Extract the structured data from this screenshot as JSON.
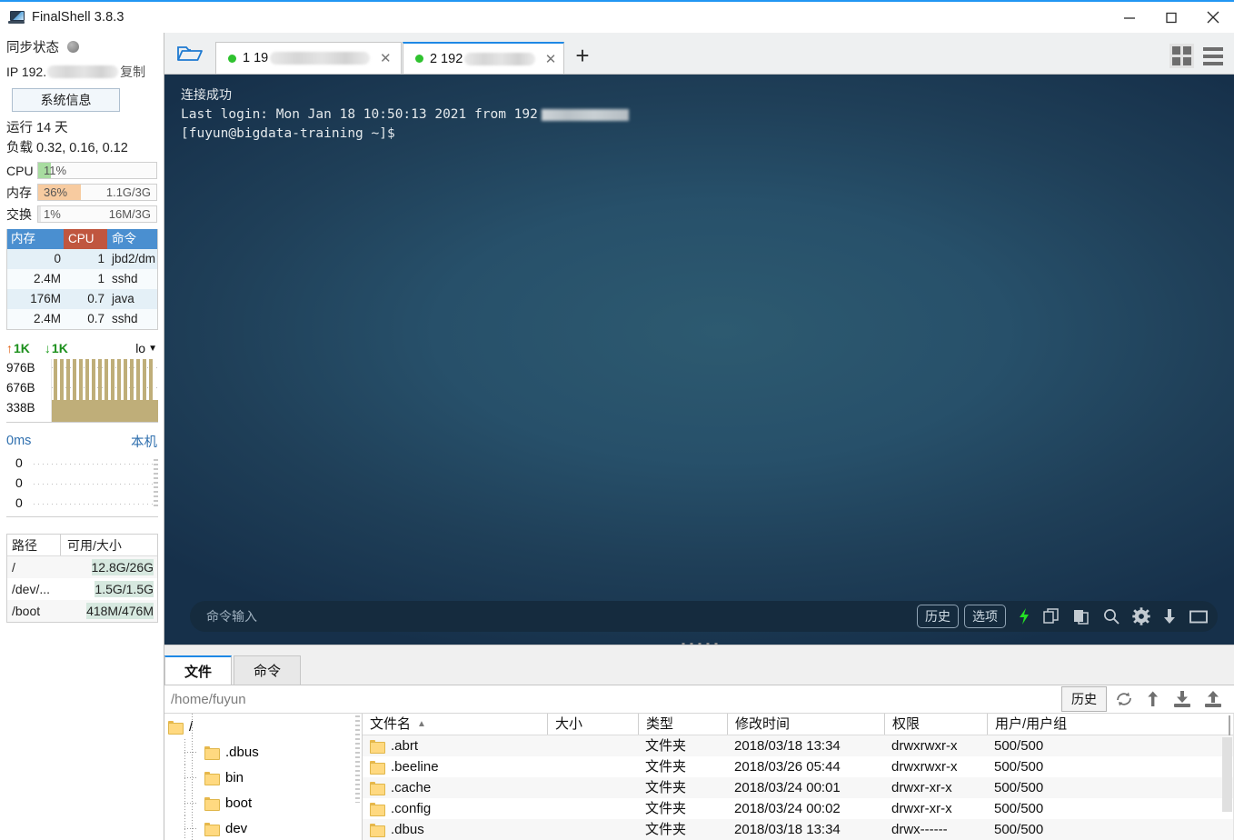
{
  "window": {
    "title": "FinalShell 3.8.3",
    "app_icon": "monitor-icon",
    "minimize": "minimize-icon",
    "maximize": "maximize-icon",
    "close": "close-icon"
  },
  "sidebar": {
    "sync_label": "同步状态",
    "ip_prefix": "IP 192.",
    "copy_label": "复制",
    "sysinfo_button": "系统信息",
    "uptime": "运行 14 天",
    "load": "负载 0.32, 0.16, 0.12",
    "meters": [
      {
        "label": "CPU",
        "percent": "11%",
        "fill": 11,
        "abs": "",
        "color": "#a8dca0"
      },
      {
        "label": "内存",
        "percent": "36%",
        "fill": 36,
        "abs": "1.1G/3G",
        "color": "#f7cba0"
      },
      {
        "label": "交换",
        "percent": "1%",
        "fill": 1,
        "abs": "16M/3G",
        "color": "#dddddd"
      }
    ],
    "process_table": {
      "headers": [
        "内存",
        "CPU",
        "命令"
      ],
      "rows": [
        {
          "mem": "0",
          "cpu": "1",
          "cmd": "jbd2/dm"
        },
        {
          "mem": "2.4M",
          "cpu": "1",
          "cmd": "sshd"
        },
        {
          "mem": "176M",
          "cpu": "0.7",
          "cmd": "java"
        },
        {
          "mem": "2.4M",
          "cpu": "0.7",
          "cmd": "sshd"
        }
      ]
    },
    "network": {
      "up_value": "1K",
      "down_value": "1K",
      "interface": "lo",
      "y_labels": [
        "976B",
        "676B",
        "338B"
      ]
    },
    "ping": {
      "latency": "0ms",
      "host": "本机",
      "y_labels": [
        "0",
        "0",
        "0"
      ]
    },
    "disks": {
      "headers": [
        "路径",
        "可用/大小"
      ],
      "rows": [
        {
          "path": "/",
          "usage": "12.8G/26G"
        },
        {
          "path": "/dev/...",
          "usage": "1.5G/1.5G"
        },
        {
          "path": "/boot",
          "usage": "418M/476M"
        }
      ]
    }
  },
  "tabbar": {
    "open_folder_icon": "open-folder-icon",
    "tabs": [
      {
        "label": "1 19",
        "active": false,
        "status": "connected"
      },
      {
        "label": "2 192",
        "active": true,
        "status": "connected"
      }
    ],
    "new_tab": "+",
    "grid_view_icon": "grid-view-icon",
    "menu_icon": "hamburger-menu-icon"
  },
  "terminal": {
    "line1": "连接成功",
    "line2": "Last login: Mon Jan 18 10:50:13 2021 from 192",
    "line3": "[fuyun@bigdata-training ~]$",
    "command_placeholder": "命令输入",
    "command_value": "",
    "history_button": "历史",
    "options_button": "选项",
    "icons": [
      "lightning-icon",
      "copy-icon",
      "paste-icon",
      "search-icon",
      "gear-icon",
      "download-icon",
      "window-icon"
    ]
  },
  "filepanel": {
    "tabs": [
      {
        "label": "文件",
        "active": true
      },
      {
        "label": "命令",
        "active": false
      }
    ],
    "path": "/home/fuyun",
    "history_button": "历史",
    "toolbar_icons": [
      "refresh-icon",
      "parent-dir-icon",
      "download-icon",
      "upload-icon"
    ],
    "tree": [
      {
        "label": "/",
        "depth": 0
      },
      {
        "label": ".dbus",
        "depth": 1
      },
      {
        "label": "bin",
        "depth": 1
      },
      {
        "label": "boot",
        "depth": 1
      },
      {
        "label": "dev",
        "depth": 1
      }
    ],
    "columns": [
      "文件名",
      "大小",
      "类型",
      "修改时间",
      "权限",
      "用户/用户组"
    ],
    "sort_indicator": "▲",
    "rows": [
      {
        "name": ".abrt",
        "size": "",
        "type": "文件夹",
        "mtime": "2018/03/18 13:34",
        "perm": "drwxrwxr-x",
        "owner": "500/500"
      },
      {
        "name": ".beeline",
        "size": "",
        "type": "文件夹",
        "mtime": "2018/03/26 05:44",
        "perm": "drwxrwxr-x",
        "owner": "500/500"
      },
      {
        "name": ".cache",
        "size": "",
        "type": "文件夹",
        "mtime": "2018/03/24 00:01",
        "perm": "drwxr-xr-x",
        "owner": "500/500"
      },
      {
        "name": ".config",
        "size": "",
        "type": "文件夹",
        "mtime": "2018/03/24 00:02",
        "perm": "drwxr-xr-x",
        "owner": "500/500"
      },
      {
        "name": ".dbus",
        "size": "",
        "type": "文件夹",
        "mtime": "2018/03/18 13:34",
        "perm": "drwx------",
        "owner": "500/500"
      }
    ]
  },
  "colors": {
    "accent": "#1e88e5",
    "terminal_bg": "#1f3f58",
    "green_status": "#2fc22f",
    "cpu_header": "#c0563f",
    "mem_header": "#4a8fd0"
  }
}
